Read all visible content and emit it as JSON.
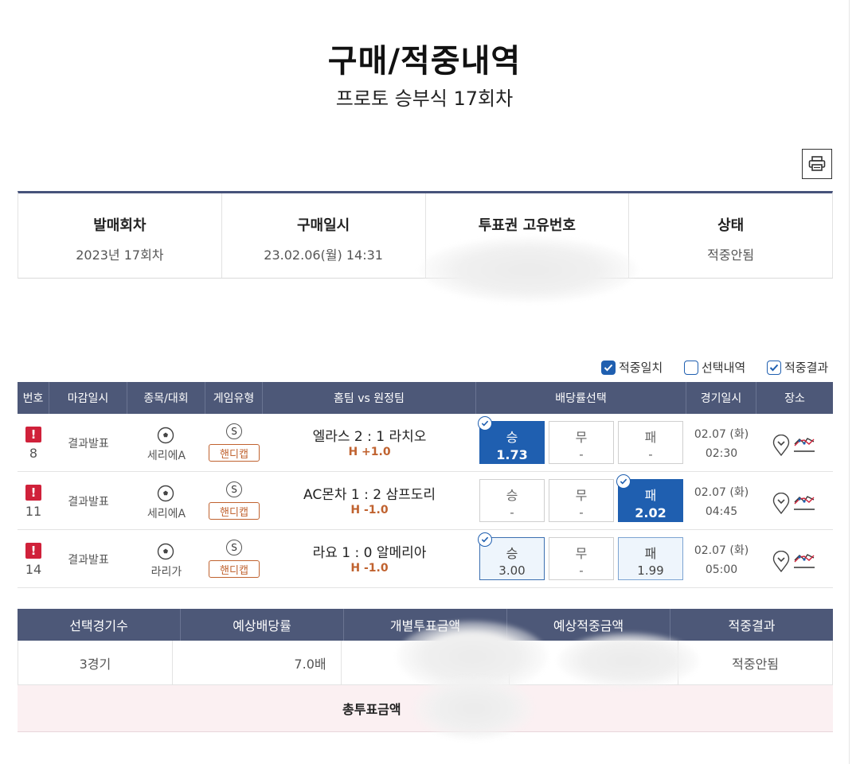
{
  "page": {
    "title": "구매/적중내역",
    "subtitle": "프로토 승부식 17회차"
  },
  "toolbar": {
    "print_icon": "printer-icon"
  },
  "purchase_info": {
    "headers": [
      "발매회차",
      "구매일시",
      "투표권 고유번호",
      "상태"
    ],
    "values": [
      "2023년 17회차",
      "23.02.06(월) 14:31",
      "",
      "적중안됨"
    ]
  },
  "legend": {
    "items": [
      "적중일치",
      "선택내역",
      "적중결과"
    ]
  },
  "games": {
    "headers": [
      "번호",
      "마감일시",
      "종목/대회",
      "게임유형",
      "홈팀 vs 원정팀",
      "배당률선택",
      "경기일시",
      "장소"
    ],
    "rows": [
      {
        "no": "8",
        "status": "결과발표",
        "league": "세리에A",
        "type_badge": "S",
        "type": "핸디캡",
        "match": "엘라스 2 : 1 라치오",
        "handicap": "H +1.0",
        "odds": [
          {
            "label": "승",
            "value": "1.73"
          },
          {
            "label": "무",
            "value": "-"
          },
          {
            "label": "패",
            "value": "-"
          }
        ],
        "date": "02.07 (화)",
        "time": "02:30"
      },
      {
        "no": "11",
        "status": "결과발표",
        "league": "세리에A",
        "type_badge": "S",
        "type": "핸디캡",
        "match": "AC몬차 1 : 2 삼프도리",
        "handicap": "H -1.0",
        "odds": [
          {
            "label": "승",
            "value": "-"
          },
          {
            "label": "무",
            "value": "-"
          },
          {
            "label": "패",
            "value": "2.02"
          }
        ],
        "date": "02.07 (화)",
        "time": "04:45"
      },
      {
        "no": "14",
        "status": "결과발표",
        "league": "라리가",
        "type_badge": "S",
        "type": "핸디캡",
        "match": "라요 1 : 0 알메리아",
        "handicap": "H -1.0",
        "odds": [
          {
            "label": "승",
            "value": "3.00"
          },
          {
            "label": "무",
            "value": "-"
          },
          {
            "label": "패",
            "value": "1.99"
          }
        ],
        "date": "02.07 (화)",
        "time": "05:00"
      }
    ]
  },
  "summary": {
    "headers": [
      "선택경기수",
      "예상배당률",
      "개별투표금액",
      "예상적중금액",
      "적중결과"
    ],
    "values": [
      "3경기",
      "7.0배",
      "",
      "",
      "적중안됨"
    ],
    "total_label": "총투표금액"
  },
  "colors": {
    "header_bg": "#4d5878",
    "accent_blue": "#1f5fb0",
    "handicap_orange": "#c0622f",
    "alert_red": "#d0213a",
    "total_bg": "#fbf0f2"
  }
}
